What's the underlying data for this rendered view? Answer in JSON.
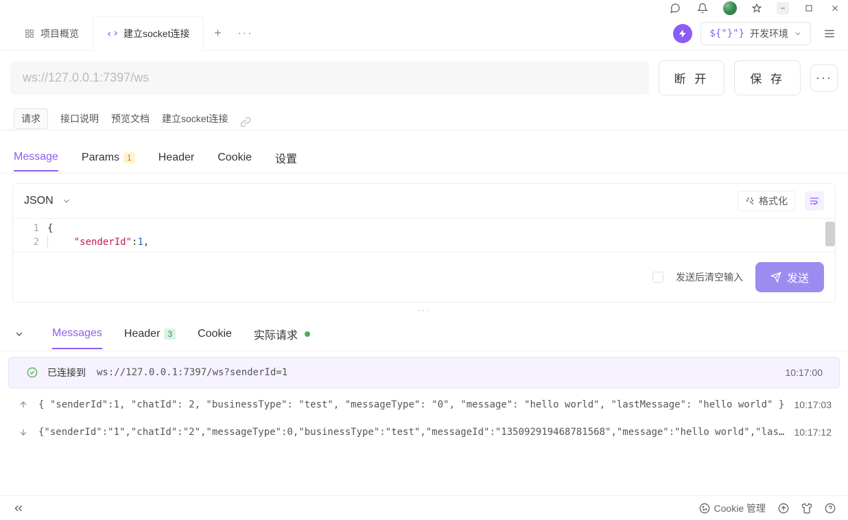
{
  "titlebar": {},
  "tabs": {
    "overview": {
      "label": "项目概览"
    },
    "active": {
      "label": "建立socket连接"
    }
  },
  "env": {
    "label": "开发环境"
  },
  "url": {
    "value": "ws://127.0.0.1:7397/ws"
  },
  "actions": {
    "disconnect": "断 开",
    "save": "保 存"
  },
  "subtabs": {
    "request": "请求",
    "api_desc": "接口说明",
    "preview_doc": "预览文档",
    "title": "建立socket连接"
  },
  "reqtabs": {
    "message": "Message",
    "params": "Params",
    "params_badge": "1",
    "header": "Header",
    "cookie": "Cookie",
    "settings": "设置"
  },
  "editor": {
    "format": "JSON",
    "format_btn": "格式化",
    "lines": {
      "1": "1",
      "2": "2"
    },
    "code_line1": "{",
    "code_line2_key": "\"senderId\"",
    "code_line2_sep": ":",
    "code_line2_val": "1",
    "code_line2_comma": ",",
    "clear_after_send": "发送后清空输入",
    "send": "发送"
  },
  "resp": {
    "messages": "Messages",
    "header": "Header",
    "header_badge": "3",
    "cookie": "Cookie",
    "actual": "实际请求"
  },
  "messages": {
    "connected": {
      "label": "已连接到",
      "url": "ws://127.0.0.1:7397/ws?senderId=1",
      "ts": "10:17:00"
    },
    "sent": {
      "text": "{ \"senderId\":1, \"chatId\": 2, \"businessType\": \"test\", \"messageType\": \"0\", \"message\": \"hello world\", \"lastMessage\": \"hello world\" }",
      "ts": "10:17:03"
    },
    "recv": {
      "text": "{\"senderId\":\"1\",\"chatId\":\"2\",\"messageType\":0,\"businessType\":\"test\",\"messageId\":\"135092919468781568\",\"message\":\"hello world\",\"lastM...",
      "ts": "10:17:12"
    }
  },
  "footer": {
    "cookie_mgmt": "Cookie 管理"
  }
}
